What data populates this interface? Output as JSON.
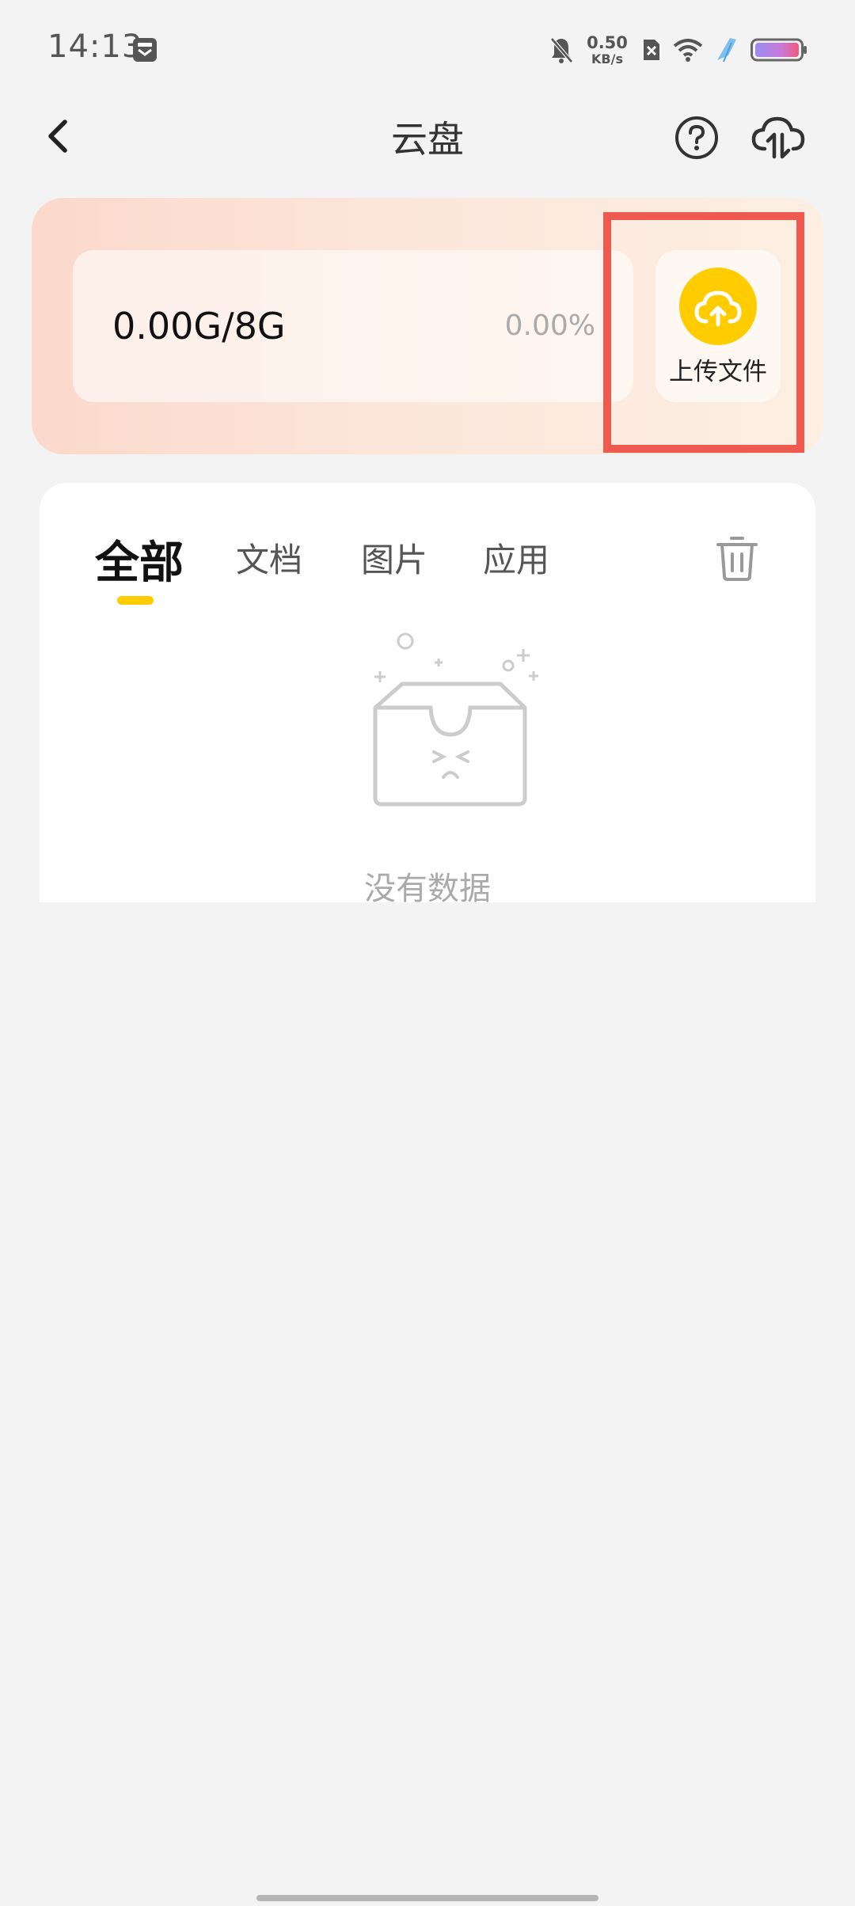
{
  "status_bar": {
    "time": "14:13",
    "net_speed_value": "0.50",
    "net_speed_unit": "KB/s",
    "icons": [
      "app-notification-icon",
      "bell-muted-icon",
      "sim-off-icon",
      "wifi-icon",
      "charging-bolt-icon",
      "battery-icon"
    ]
  },
  "header": {
    "title": "云盘",
    "back_icon": "chevron-left-icon",
    "help_icon": "question-circle-icon",
    "transfer_icon": "cloud-transfer-icon"
  },
  "storage": {
    "used_label": "0.00G/8G",
    "percent_label": "0.00%",
    "upload_label": "上传文件",
    "upload_icon": "cloud-upload-icon",
    "card_colors": [
      "#fbd9cc",
      "#fcefe2"
    ],
    "accent": "#ffcc00",
    "highlight_color": "#ee5a50"
  },
  "tabs": [
    {
      "label": "全部",
      "active": true
    },
    {
      "label": "文档",
      "active": false
    },
    {
      "label": "图片",
      "active": false
    },
    {
      "label": "应用",
      "active": false
    }
  ],
  "trash_icon": "trash-icon",
  "empty_state": {
    "text": "没有数据",
    "icon": "empty-box-icon"
  }
}
